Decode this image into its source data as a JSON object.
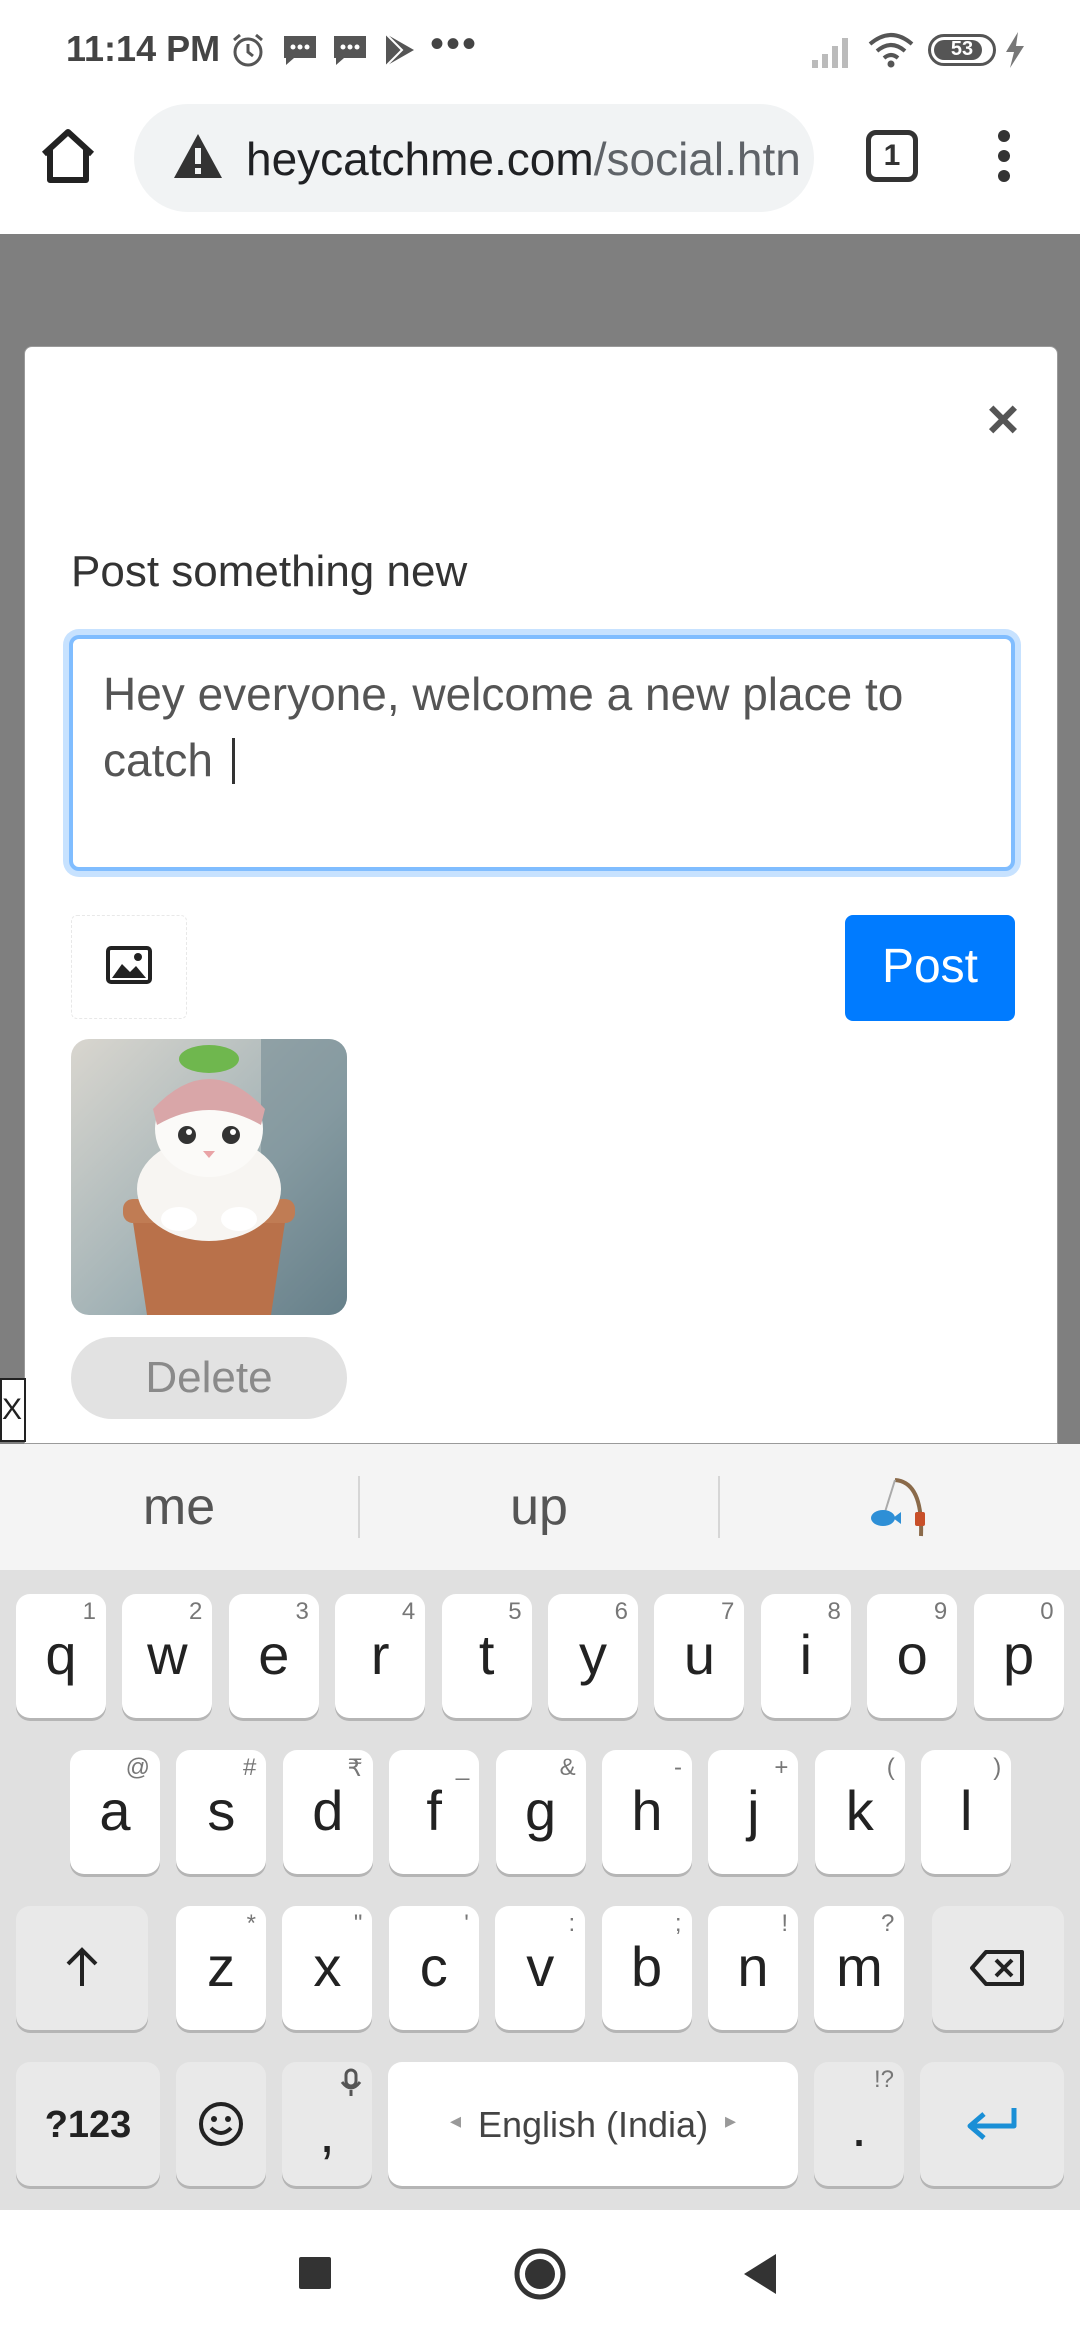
{
  "status_bar": {
    "time": "11:14 PM",
    "left_icons": [
      "alarm-icon",
      "message-icon",
      "message-icon",
      "play-store-icon"
    ],
    "more": "•••",
    "battery": "53",
    "right_icons": [
      "signal-icon",
      "wifi-icon",
      "battery-icon",
      "charging-icon"
    ]
  },
  "browser": {
    "url_host": "heycatchme.com",
    "url_path": "/social.htn",
    "tab_count": "1"
  },
  "modal": {
    "close": "×",
    "title": "Post something new",
    "text_value": "Hey everyone, welcome a new place to catch ",
    "post_label": "Post",
    "delete_label": "Delete",
    "side_x": "X"
  },
  "keyboard": {
    "suggestions": [
      "me",
      "up"
    ],
    "row1": [
      {
        "k": "q",
        "h": "1"
      },
      {
        "k": "w",
        "h": "2"
      },
      {
        "k": "e",
        "h": "3"
      },
      {
        "k": "r",
        "h": "4"
      },
      {
        "k": "t",
        "h": "5"
      },
      {
        "k": "y",
        "h": "6"
      },
      {
        "k": "u",
        "h": "7"
      },
      {
        "k": "i",
        "h": "8"
      },
      {
        "k": "o",
        "h": "9"
      },
      {
        "k": "p",
        "h": "0"
      }
    ],
    "row2": [
      {
        "k": "a",
        "h": "@"
      },
      {
        "k": "s",
        "h": "#"
      },
      {
        "k": "d",
        "h": "₹"
      },
      {
        "k": "f",
        "h": "_"
      },
      {
        "k": "g",
        "h": "&"
      },
      {
        "k": "h",
        "h": "-"
      },
      {
        "k": "j",
        "h": "+"
      },
      {
        "k": "k",
        "h": "("
      },
      {
        "k": "l",
        "h": ")"
      }
    ],
    "row3": [
      {
        "k": "z",
        "h": "*"
      },
      {
        "k": "x",
        "h": "\""
      },
      {
        "k": "c",
        "h": "'"
      },
      {
        "k": "v",
        "h": ":"
      },
      {
        "k": "b",
        "h": ";"
      },
      {
        "k": "n",
        "h": "!"
      },
      {
        "k": "m",
        "h": "?"
      }
    ],
    "sym_label": "?123",
    "comma": ",",
    "space_label": "English (India)",
    "period": ".",
    "period_hint": "!?"
  },
  "colors": {
    "accent": "#007bff",
    "focus_ring": "#80bdff",
    "backdrop": "#7f7f7f",
    "keyboard_bg": "#e0e0e0",
    "enter_key": "#1a8fd6"
  }
}
